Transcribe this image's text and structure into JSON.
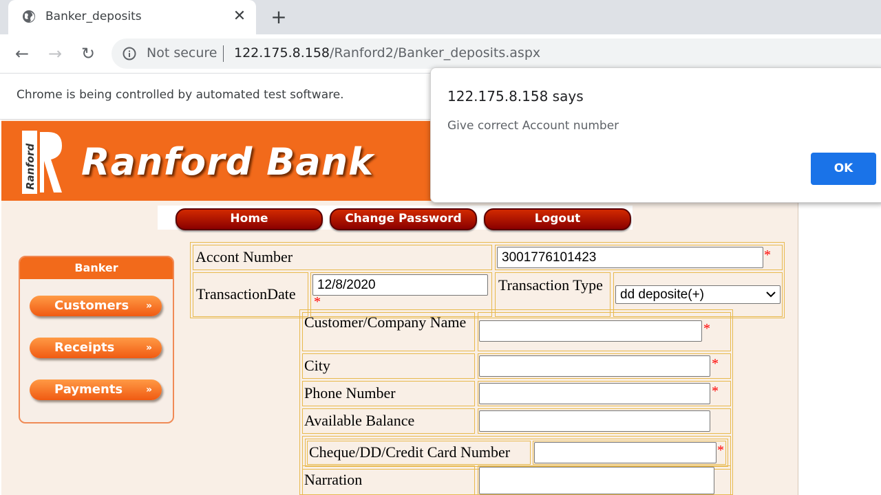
{
  "browser": {
    "tab_title": "Banker_deposits",
    "tab_close": "✕",
    "new_tab": "+",
    "back": "←",
    "forward": "→",
    "reload": "↻",
    "security_label": "Not secure",
    "url_host": "122.175.8.158",
    "url_path": "/Ranford2/Banker_deposits.aspx",
    "automation_notice": "Chrome is being controlled by automated test software."
  },
  "site": {
    "bank_name": "Ranford Bank",
    "logo_text": "Ranford",
    "banner_color": "#f26a1b",
    "nav": [
      "Home",
      "Change Password",
      "Logout"
    ]
  },
  "sidebar": {
    "title": "Banker",
    "items": [
      "Customers",
      "Receipts",
      "Payments"
    ],
    "arrow": "»"
  },
  "form": {
    "account_number_label": "Accont Number",
    "account_number_value": "3001776101423",
    "transaction_date_label": "TransactionDate",
    "transaction_date_value": "12/8/2020",
    "transaction_type_label": "Transaction Type",
    "transaction_type_value": "dd deposite(+)",
    "customer_name_label": "Customer/Company Name",
    "customer_name_value": "",
    "city_label": "City",
    "city_value": "",
    "phone_label": "Phone Number",
    "phone_value": "",
    "balance_label": "Available Balance",
    "balance_value": "",
    "cheque_label": "Cheque/DD/Credit Card Number",
    "cheque_value": "",
    "narration_label": "Narration",
    "narration_value": "",
    "required_mark": "*"
  },
  "dialog": {
    "title": "122.175.8.158 says",
    "message": "Give correct Account number",
    "ok_label": "OK",
    "ok_color": "#1a73e8"
  }
}
